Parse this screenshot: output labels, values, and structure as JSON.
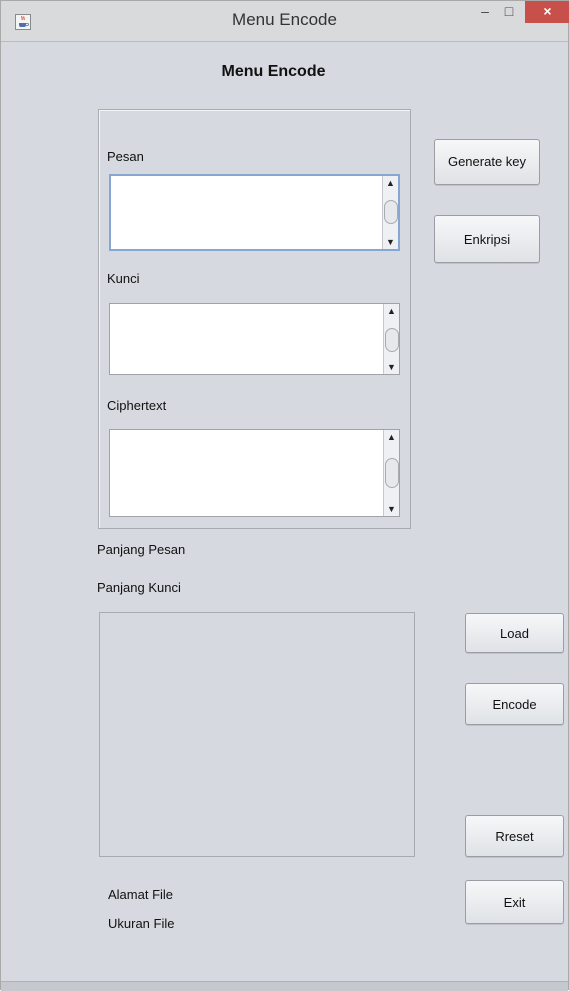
{
  "window": {
    "title": "Menu Encode",
    "minimize": "–",
    "maximize": "□",
    "close": "×"
  },
  "heading": "Menu Encode",
  "form": {
    "pesan_label": "Pesan",
    "kunci_label": "Kunci",
    "ciphertext_label": "Ciphertext",
    "pesan_value": "",
    "kunci_value": "",
    "ciphertext_value": ""
  },
  "buttons": {
    "generate_key": "Generate key",
    "enkripsi": "Enkripsi",
    "load": "Load",
    "encode": "Encode",
    "reset": "Rreset",
    "exit": "Exit"
  },
  "info": {
    "panjang_pesan": "Panjang Pesan",
    "panjang_kunci": "Panjang Kunci",
    "alamat_file": "Alamat File",
    "ukuran_file": "Ukuran File"
  },
  "scroll": {
    "up": "▲",
    "down": "▼"
  },
  "icons": {
    "app": "java-coffee-icon"
  }
}
